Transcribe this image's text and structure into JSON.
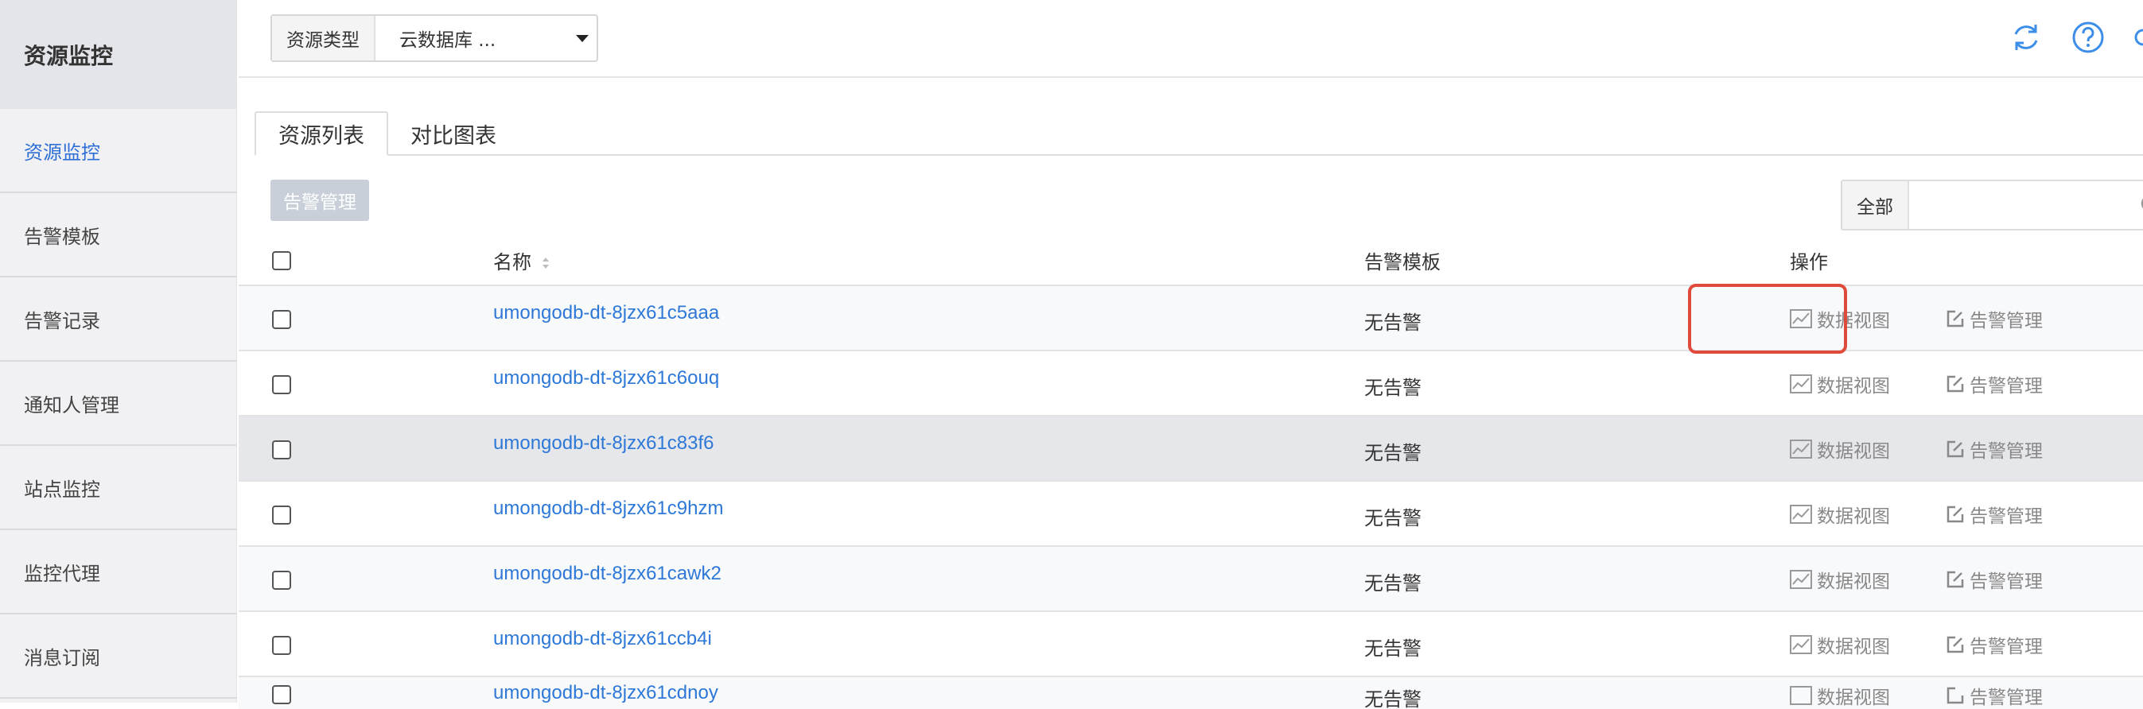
{
  "sidebar": {
    "title": "资源监控",
    "items": [
      {
        "label": "资源监控",
        "active": true
      },
      {
        "label": "告警模板"
      },
      {
        "label": "告警记录"
      },
      {
        "label": "通知人管理"
      },
      {
        "label": "站点监控"
      },
      {
        "label": "监控代理"
      },
      {
        "label": "消息订阅"
      }
    ]
  },
  "topbar": {
    "resource_type_label": "资源类型",
    "resource_type_value": "云数据库 ...",
    "icons": [
      "refresh-icon",
      "help-icon"
    ]
  },
  "tabs": [
    {
      "label": "资源列表",
      "active": true
    },
    {
      "label": "对比图表"
    }
  ],
  "toolbar": {
    "alarm_button": "告警管理",
    "filter_label": "全部",
    "filter_value": ""
  },
  "table": {
    "headers": {
      "name": "名称",
      "template": "告警模板",
      "action": "操作"
    },
    "rows": [
      {
        "name": "umongodb-dt-8jzx61c5aaa",
        "template": "无告警",
        "view": "数据视图",
        "alarm": "告警管理"
      },
      {
        "name": "umongodb-dt-8jzx61c6ouq",
        "template": "无告警",
        "view": "数据视图",
        "alarm": "告警管理"
      },
      {
        "name": "umongodb-dt-8jzx61c83f6",
        "template": "无告警",
        "view": "数据视图",
        "alarm": "告警管理"
      },
      {
        "name": "umongodb-dt-8jzx61c9hzm",
        "template": "无告警",
        "view": "数据视图",
        "alarm": "告警管理"
      },
      {
        "name": "umongodb-dt-8jzx61cawk2",
        "template": "无告警",
        "view": "数据视图",
        "alarm": "告警管理"
      },
      {
        "name": "umongodb-dt-8jzx61ccb4i",
        "template": "无告警",
        "view": "数据视图",
        "alarm": "告警管理"
      }
    ],
    "partial_row": {
      "name": "umongodb-dt-8jzx61cdnoy",
      "template": "无告警",
      "view": "数据视图",
      "alarm": "告警管理"
    }
  },
  "colors": {
    "accent": "#2d78d7",
    "highlight": "#e04a3a"
  }
}
